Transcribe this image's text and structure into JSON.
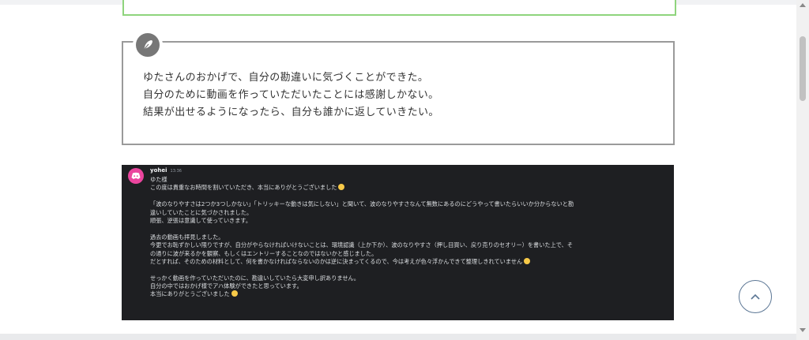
{
  "memo": {
    "icon": "pen-nib-icon",
    "lines": [
      "ゆたさんのおかげで、自分の勘違いに気づくことができた。",
      "自分のために動画を作っていただいたことには感謝しかない。",
      "結果が出せるようになったら、自分も誰かに返していきたい。"
    ]
  },
  "discord": {
    "avatar_icon": "discord-logo-icon",
    "username": "yohei",
    "timestamp": "13:36",
    "lines": [
      "ゆた様",
      "この度は貴重なお時間を割いていただき、本当にありがとうございました",
      "",
      "「波のなりやすさは2つか3つしかない」「トリッキーな動きは気にしない」と聞いて、波のなりやすさなんて無数にあるのにどうやって書いたらいいか分からないと勘",
      "違いしていたことに気づかされました。",
      "順張、逆張は意識して使っていきます。",
      "",
      "過去の動画も拝見しました。",
      "今更でお恥ずかしい限りですが、自分がやらなければいけないことは、環境認識（上か下か）、波のなりやすさ（押し目買い、戻り売りのセオリー）を書いた上で、そ",
      "の通りに波が来るかを観察、もしくはエントリーすることなのではないかと感じました。",
      "だとすれば、そのための材料として、何を書かなければならないのかは逆に決まってくるので、今は考えが色々浮かんできて整理しきれていません",
      "",
      "せっかく動画を作っていただいたのに、勘違いしていたら大変申し訳ありません。",
      "自分の中ではおかげ様でアハ体験ができたと思っています。",
      "本当にありがとうございました"
    ],
    "emoji_lines": [
      1,
      10,
      14
    ]
  },
  "scroll_top_button": {
    "icon": "chevron-up-icon"
  },
  "colors": {
    "green_border": "#8fd47d",
    "memo_border": "#9a9a9a",
    "discord_bg": "#1e1f22",
    "discord_pink": "#eb459e",
    "scroll_button_border": "#5c7795"
  }
}
